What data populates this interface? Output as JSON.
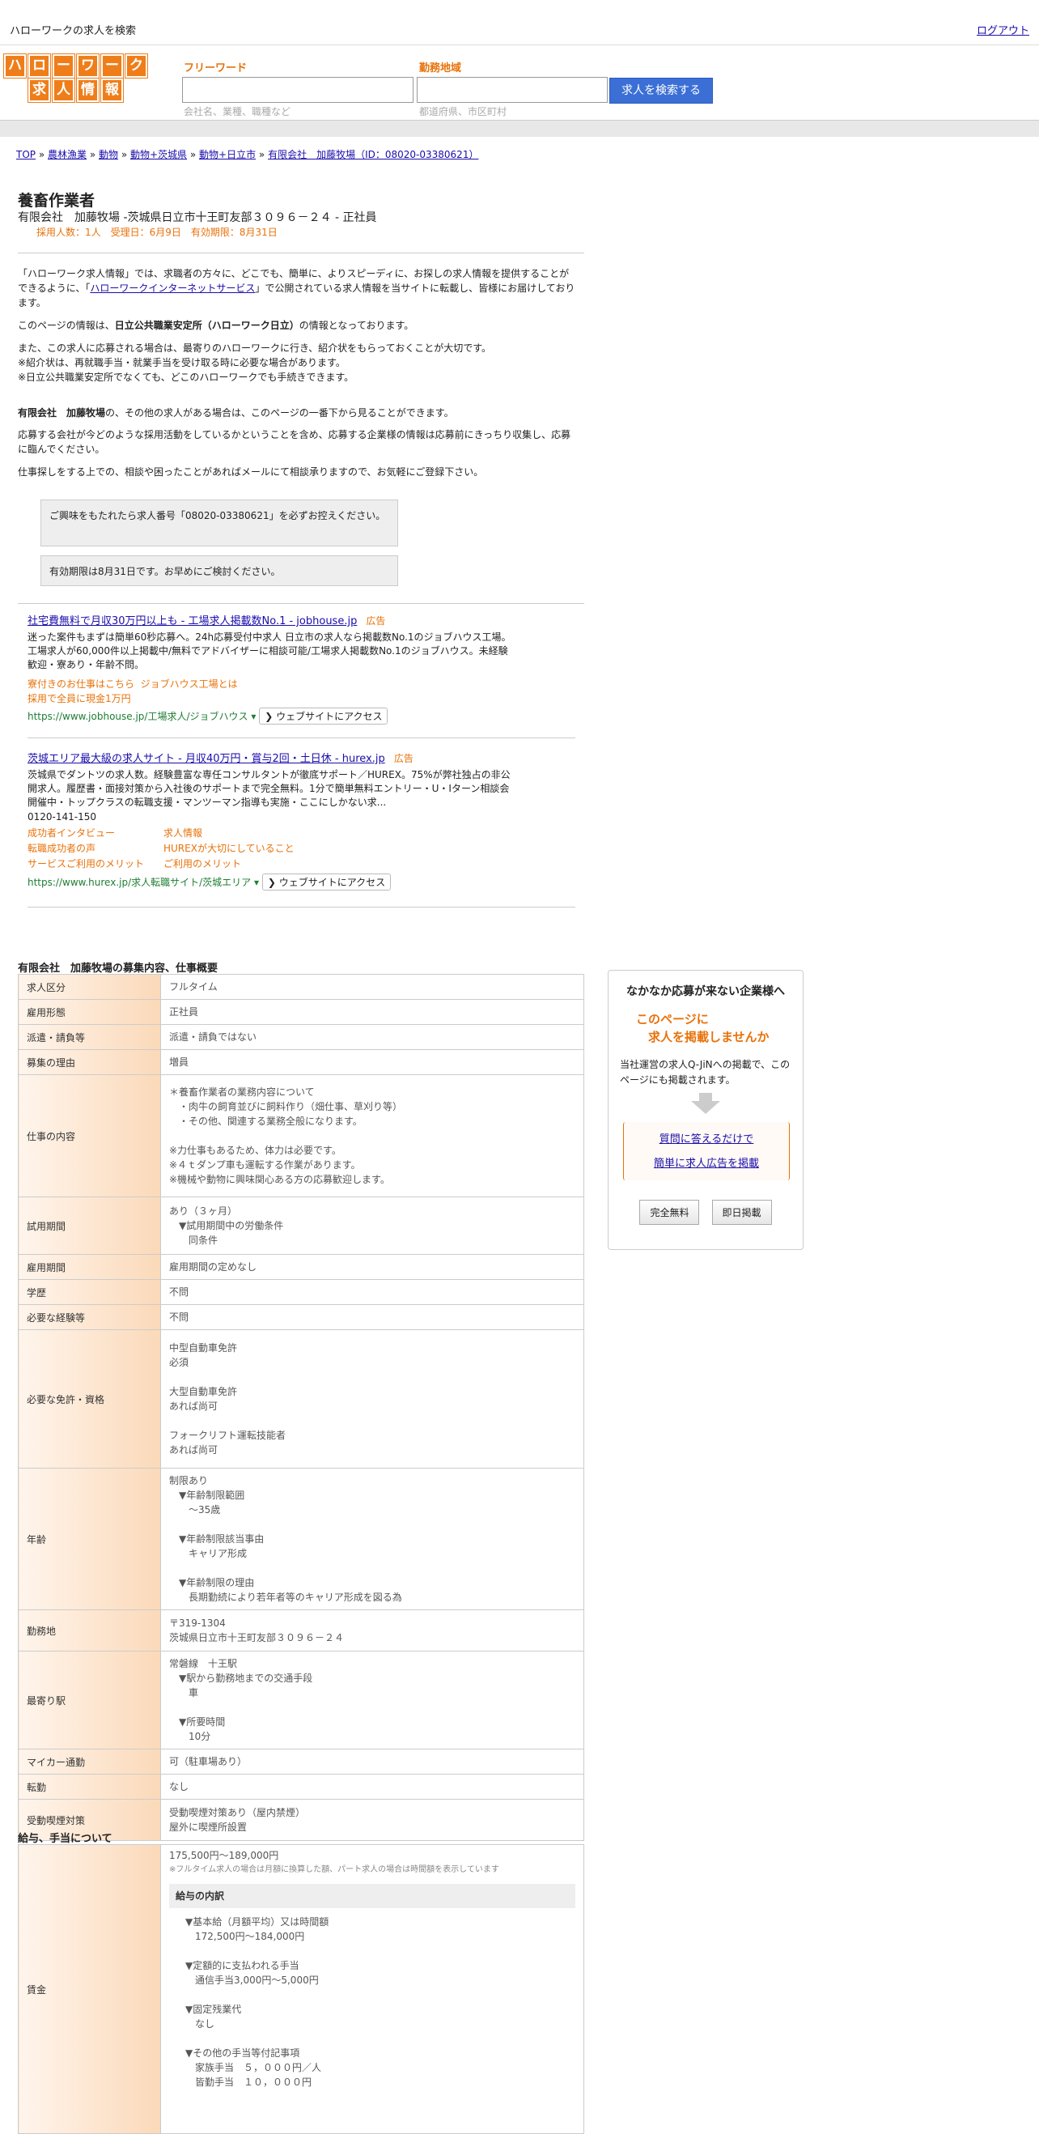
{
  "topbar": {
    "title": "ハローワークの求人を検索",
    "logout": "ログアウト"
  },
  "logo": {
    "row1": [
      "ハ",
      "ロ",
      "ー",
      "ワ",
      "ー",
      "ク"
    ],
    "row2": [
      "求",
      "人",
      "情",
      "報"
    ]
  },
  "search": {
    "freeword_label": "フリーワード",
    "freeword_placeholder": "会社名、業種、職種など",
    "area_label": "勤務地域",
    "area_placeholder": "都道府県、市区町村",
    "button": "求人を検索する"
  },
  "breadcrumb": [
    "TOP",
    "農林漁業",
    "動物",
    "動物+茨城県",
    "動物+日立市",
    "有限会社　加藤牧場（ID：08020-03380621）"
  ],
  "job": {
    "title": "養畜作業者",
    "subtitle": "有限会社　加藤牧場 -茨城県日立市十王町友部３０９６－２４ - 正社員",
    "meta": "採用人数：1人　受理日：6月9日　有効期限：8月31日"
  },
  "intro": {
    "p1": "「ハローワーク求人情報」では、求職者の方々に、どこでも、簡単に、よりスピーディに、お探しの求人情報を提供することができるように、「",
    "p1_link": "ハローワークインターネットサービス",
    "p1_end": "」で公開されている求人情報を当サイトに転載し、皆様にお届けしております。",
    "p2_pre": "このページの情報は、",
    "p2_bold": "日立公共職業安定所（ハローワーク日立）",
    "p2_post": "の情報となっております。",
    "p3": "また、この求人に応募される場合は、最寄りのハローワークに行き、紹介状をもらっておくことが大切です。",
    "p4": "※紹介状は、再就職手当・就業手当を受け取る時に必要な場合があります。",
    "p5": "※日立公共職業安定所でなくても、どこのハローワークでも手続きできます。",
    "p6_bold": "有限会社　加藤牧場",
    "p6_post": "の、その他の求人がある場合は、このページの一番下から見ることができます。",
    "p7": "応募する会社が今どのような採用活動をしているかということを含め、応募する企業様の情報は応募前にきっちり収集し、応募に臨んでください。",
    "p8": "仕事探しをする上での、相談や困ったことがあればメールにて相談承りますので、お気軽にご登録下さい。",
    "box1": "ご興味をもたれたら求人番号「08020-03380621」を必ずお控えください。",
    "box2": "有効期限は8月31日です。お早めにご検討ください。"
  },
  "ads": [
    {
      "title": "社宅費無料で月収30万円以上も - 工場求人掲載数No.1 - jobhouse.jp",
      "badge": "広告",
      "desc": "迷った案件もまずは簡単60秒応募へ。24h応募受付中求人 日立市の求人なら掲載数No.1のジョブハウス工場。工場求人が60,000件以上掲載中/無料でアドバイザーに相談可能/工場求人掲載数No.1のジョブハウス。未経験歓迎・寮あり・年齢不問。",
      "links": [
        "寮付きのお仕事はこちら",
        "ジョブハウス工場とは",
        "採用で全員に現金1万円"
      ],
      "url": "https://www.jobhouse.jp/工場求人/ジョブハウス",
      "visit": "❯ ウェブサイトにアクセス"
    },
    {
      "title": "茨城エリア最大級の求人サイト - 月収40万円・賞与2回・土日休 - hurex.jp",
      "badge": "広告",
      "desc": "茨城県でダントツの求人数。経験豊富な専任コンサルタントが徹底サポート／HUREX。75%が弊社独占の非公開求人。履歴書・面接対策から入社後のサポートまで完全無料。1分で簡単無料エントリー・U・Iターン相談会開催中・トップクラスの転職支援・マンツーマン指導も実施・ここにしかない求...",
      "phone": "0120-141-150",
      "links": [
        "成功者インタビュー",
        "求人情報",
        "転職成功者の声",
        "HUREXが大切にしていること",
        "サービスご利用のメリット",
        "ご利用のメリット"
      ],
      "url": "https://www.hurex.jp/求人転職サイト/茨城エリア",
      "visit": "❯ ウェブサイトにアクセス"
    }
  ],
  "section_title": "有限会社　加藤牧場の募集内容、仕事概要",
  "rows": [
    {
      "k": "求人区分",
      "v": "フルタイム"
    },
    {
      "k": "雇用形態",
      "v": "正社員"
    },
    {
      "k": "派遣・請負等",
      "v": "派遣・請負ではない"
    },
    {
      "k": "募集の理由",
      "v": "増員"
    },
    {
      "k": "仕事の内容",
      "v": "＊養畜作業者の業務内容について\n　・肉牛の飼育並びに飼料作り（畑仕事、草刈り等）\n　・その他、関連する業務全般になります。\n\n※力仕事もあるため、体力は必要です。\n※４ｔダンプ車も運転する作業があります。\n※機械や動物に興味関心ある方の応募歓迎します。"
    },
    {
      "k": "試用期間",
      "v": "あり（３ヶ月）\n　▼試用期間中の労働条件\n　　同条件"
    },
    {
      "k": "雇用期間",
      "v": "雇用期間の定めなし"
    },
    {
      "k": "学歴",
      "v": "不問"
    },
    {
      "k": "必要な経験等",
      "v": "不問"
    },
    {
      "k": "必要な免許・資格",
      "v": "中型自動車免許\n必須\n\n大型自動車免許\nあれば尚可\n\nフォークリフト運転技能者\nあれば尚可"
    },
    {
      "k": "年齢",
      "v": "制限あり\n　▼年齢制限範囲\n　　〜35歳\n\n　▼年齢制限該当事由\n　　キャリア形成\n\n　▼年齢制限の理由\n　　長期勤続により若年者等のキャリア形成を図る為"
    },
    {
      "k": "勤務地",
      "v": "〒319-1304\n茨城県日立市十王町友部３０９６－２４"
    },
    {
      "k": "最寄り駅",
      "v": "常磐線　十王駅\n　▼駅から勤務地までの交通手段\n　　車\n\n　▼所要時間\n　　10分"
    },
    {
      "k": "マイカー通勤",
      "v": "可（駐車場あり）"
    },
    {
      "k": "転勤",
      "v": "なし"
    },
    {
      "k": "受動喫煙対策",
      "v": "受動喫煙対策あり（屋内禁煙）\n屋外に喫煙所設置"
    }
  ],
  "salary": {
    "title": "給与、手当について",
    "k": "賃金",
    "range": "175,500円〜189,000円",
    "note": "※フルタイム求人の場合は月額に換算した額、パート求人の場合は時間額を表示しています",
    "inner_head": "給与の内訳",
    "lines": "▼基本給（月額平均）又は時間額\n　172,500円〜184,000円\n\n▼定額的に支払われる手当\n　通信手当3,000円〜5,000円\n\n▼固定残業代\n　なし\n\n▼その他の手当等付記事項\n　家族手当　５，０００円／人\n　皆勤手当　１０，０００円"
  },
  "side": {
    "title": "なかなか応募が来ない企業様へ",
    "headline1": "このページに",
    "headline2": "求人を掲載しませんか",
    "desc": "当社運営の求人Q-JiNへの掲載で、このページにも掲載されます。",
    "link1": "質問に答えるだけで",
    "link2": "簡単に求人広告を掲載",
    "btn1": "完全無料",
    "btn2": "即日掲載"
  }
}
